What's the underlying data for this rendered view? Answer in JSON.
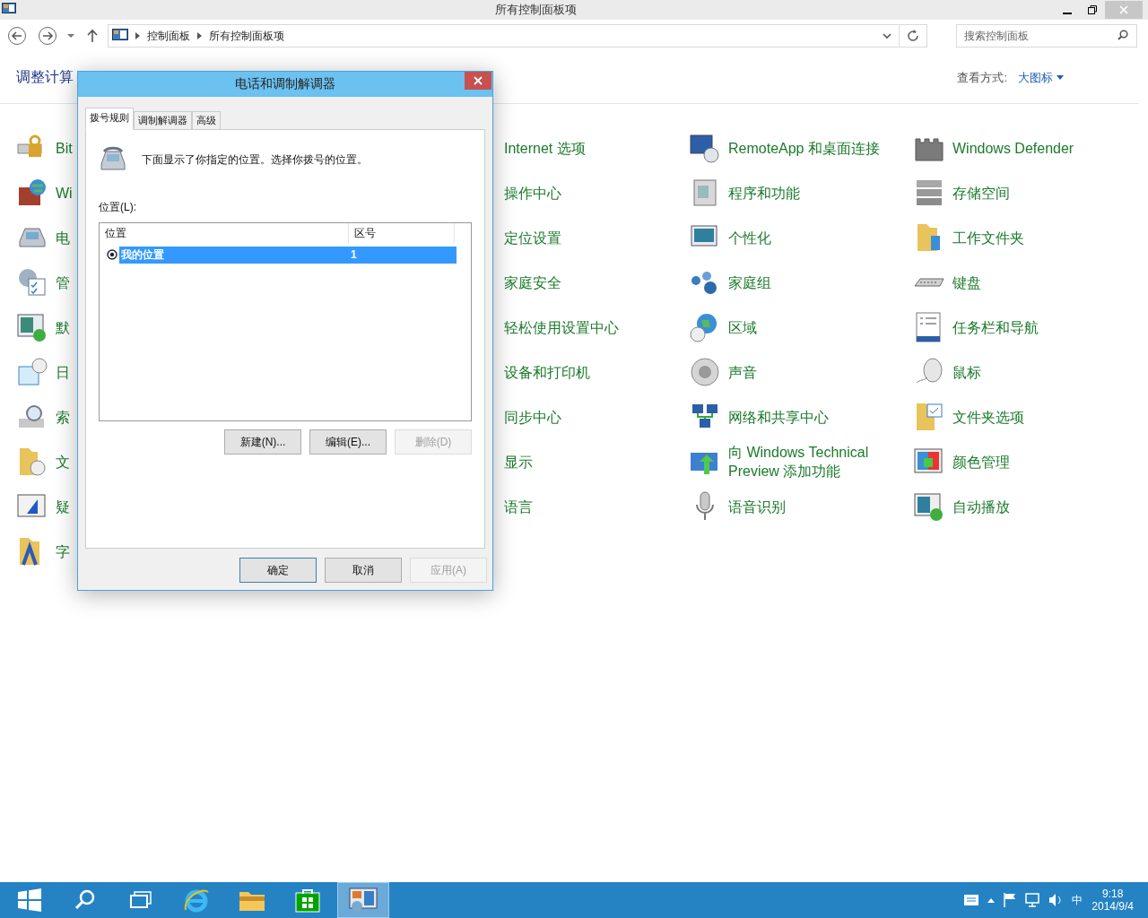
{
  "window": {
    "title": "所有控制面板项",
    "breadcrumb": [
      "控制面板",
      "所有控制面板项"
    ],
    "search_placeholder": "搜索控制面板",
    "heading": "调整计算",
    "view_label": "查看方式:",
    "view_value": "大图标"
  },
  "columns": [
    {
      "items": [
        {
          "label": "Bit"
        },
        {
          "label": "Wi"
        },
        {
          "label": "电"
        },
        {
          "label": "管"
        },
        {
          "label": "默"
        },
        {
          "label": "日"
        },
        {
          "label": "索"
        },
        {
          "label": "文"
        },
        {
          "label": "疑"
        },
        {
          "label": "字"
        }
      ]
    },
    {
      "items": [
        {
          "label": "Internet 选项"
        },
        {
          "label": "操作中心"
        },
        {
          "label": "定位设置"
        },
        {
          "label": "家庭安全"
        },
        {
          "label": "轻松使用设置中心"
        },
        {
          "label": "设备和打印机"
        },
        {
          "label": "同步中心"
        },
        {
          "label": "显示"
        },
        {
          "label": "语言"
        }
      ]
    },
    {
      "items": [
        {
          "label": "RemoteApp 和桌面连接"
        },
        {
          "label": "程序和功能"
        },
        {
          "label": "个性化"
        },
        {
          "label": "家庭组"
        },
        {
          "label": "区域"
        },
        {
          "label": "声音"
        },
        {
          "label": "网络和共享中心"
        },
        {
          "label": "向 Windows Technical Preview 添加功能"
        },
        {
          "label": "语音识别"
        }
      ]
    },
    {
      "items": [
        {
          "label": "Windows Defender"
        },
        {
          "label": "存储空间"
        },
        {
          "label": "工作文件夹"
        },
        {
          "label": "键盘"
        },
        {
          "label": "任务栏和导航"
        },
        {
          "label": "鼠标"
        },
        {
          "label": "文件夹选项"
        },
        {
          "label": "颜色管理"
        },
        {
          "label": "自动播放"
        }
      ]
    }
  ],
  "dialog": {
    "title": "电话和调制解调器",
    "tabs": [
      {
        "label": "拨号规则",
        "selected": true
      },
      {
        "label": "调制解调器",
        "selected": false
      },
      {
        "label": "高级",
        "selected": false
      }
    ],
    "description": "下面显示了你指定的位置。选择你拨号的位置。",
    "list_label": "位置(L):",
    "columns": [
      "位置",
      "区号"
    ],
    "rows": [
      {
        "location": "我的位置",
        "code": "1",
        "selected": true
      }
    ],
    "buttons": [
      {
        "label": "新建(N)...",
        "disabled": false
      },
      {
        "label": "编辑(E)...",
        "disabled": false
      },
      {
        "label": "删除(D)",
        "disabled": true
      }
    ],
    "footer_buttons": [
      {
        "label": "确定",
        "disabled": false,
        "default": true
      },
      {
        "label": "取消",
        "disabled": false,
        "default": false
      },
      {
        "label": "应用(A)",
        "disabled": true,
        "default": false
      }
    ]
  },
  "taskbar": {
    "apps": [
      {
        "kind": "start",
        "selected": false
      },
      {
        "kind": "search",
        "selected": false
      },
      {
        "kind": "taskview",
        "selected": false
      },
      {
        "kind": "browser",
        "selected": false
      },
      {
        "kind": "explorer",
        "selected": false
      },
      {
        "kind": "store",
        "selected": false
      },
      {
        "kind": "controlpanel",
        "selected": true
      }
    ],
    "ime": "中",
    "time": "9:18",
    "date": "2014/9/4"
  }
}
